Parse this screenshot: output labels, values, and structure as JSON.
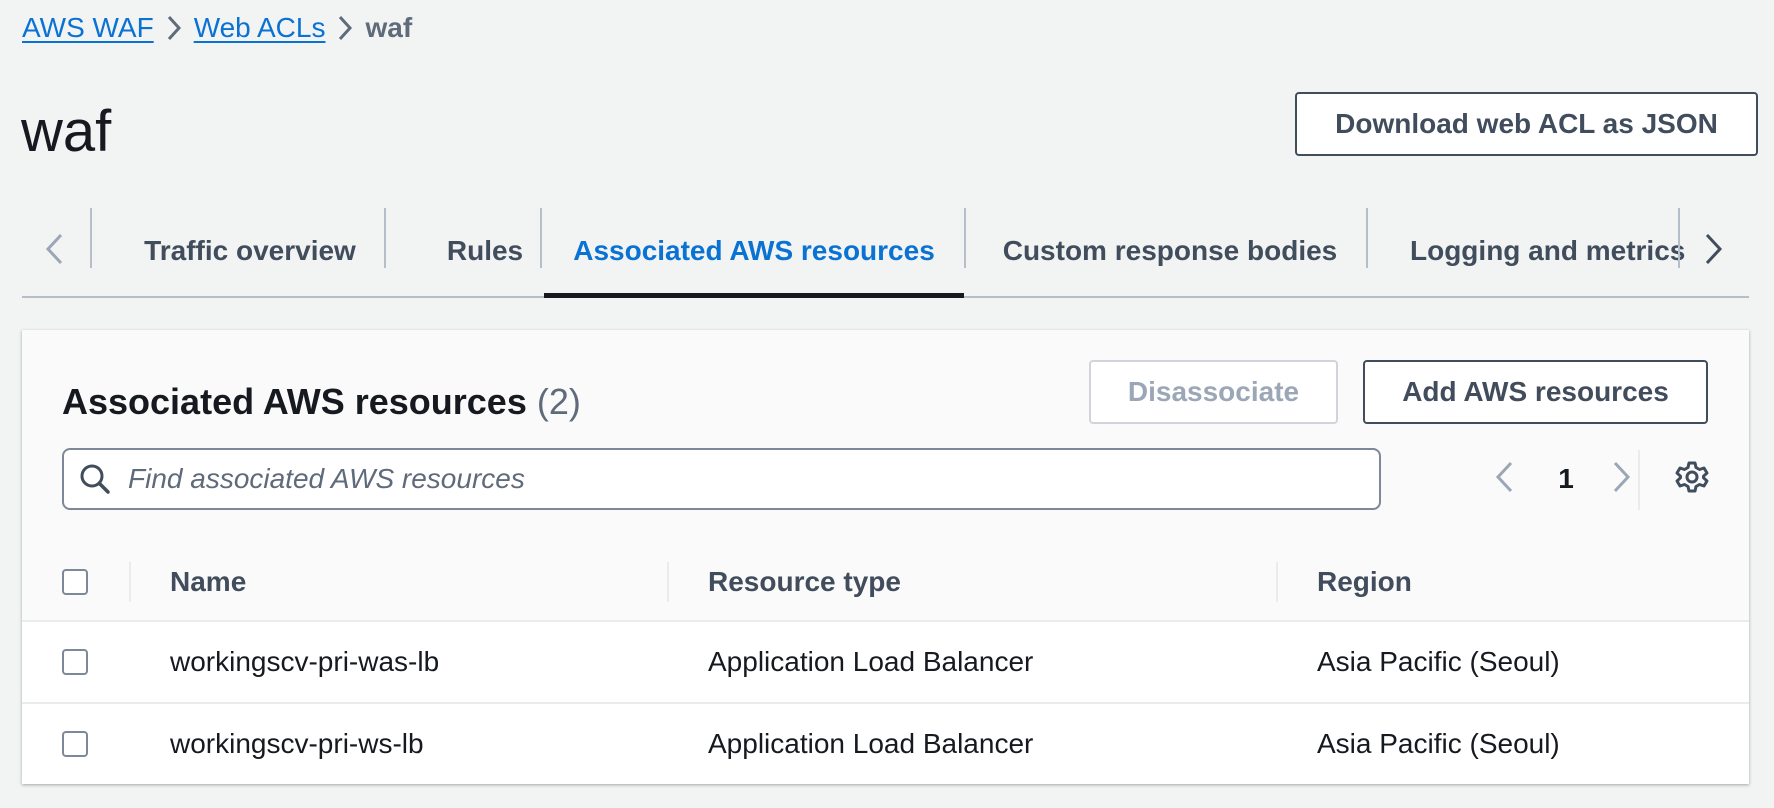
{
  "breadcrumb": {
    "items": [
      "AWS WAF",
      "Web ACLs"
    ],
    "current": "waf"
  },
  "page": {
    "title": "waf",
    "download_label": "Download web ACL as JSON"
  },
  "tabs": [
    {
      "label": "Traffic overview",
      "active": false
    },
    {
      "label": "Rules",
      "active": false
    },
    {
      "label": "Associated AWS resources",
      "active": true
    },
    {
      "label": "Custom response bodies",
      "active": false
    },
    {
      "label": "Logging and metrics",
      "active": false
    }
  ],
  "panel": {
    "title": "Associated AWS resources",
    "count": "(2)",
    "disassociate_label": "Disassociate",
    "add_label": "Add AWS resources",
    "search_placeholder": "Find associated AWS resources",
    "search_value": "",
    "current_page": "1"
  },
  "table": {
    "columns": [
      "Name",
      "Resource type",
      "Region"
    ],
    "rows": [
      {
        "name": "workingscv-pri-was-lb",
        "type": "Application Load Balancer",
        "region": "Asia Pacific (Seoul)"
      },
      {
        "name": "workingscv-pri-ws-lb",
        "type": "Application Load Balancer",
        "region": "Asia Pacific (Seoul)"
      }
    ]
  },
  "colors": {
    "link": "#0972d3",
    "text": "#16191f",
    "muted": "#5f6b7a",
    "border": "#7d8998",
    "background": "#f2f3f3"
  },
  "icons": [
    "chevron-right-icon",
    "chevron-left-icon",
    "search-icon",
    "gear-icon"
  ]
}
